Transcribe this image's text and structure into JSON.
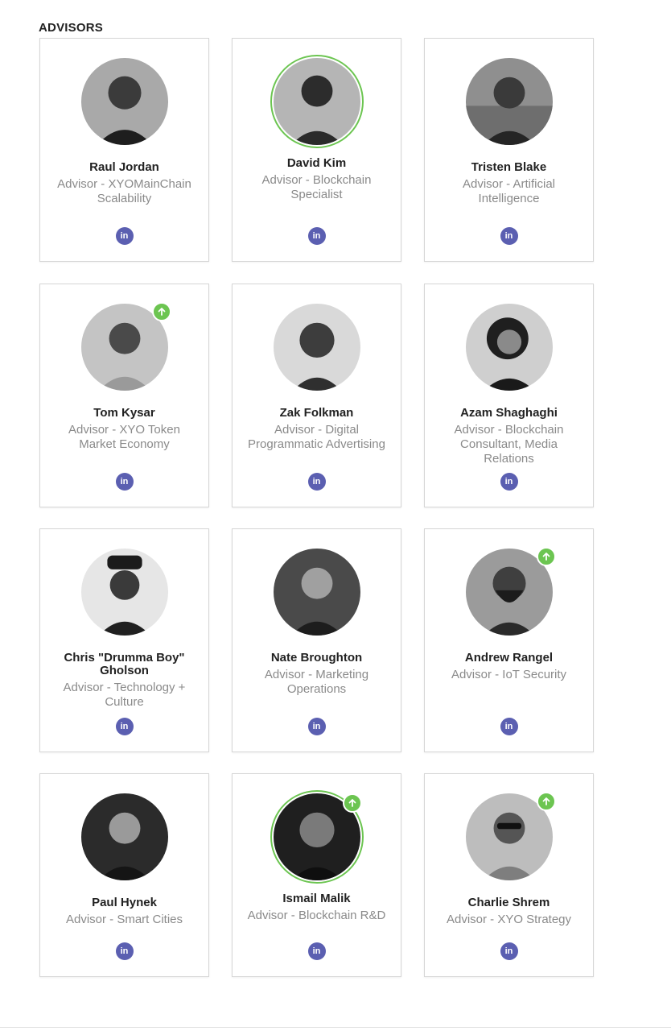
{
  "section": {
    "title": "ADVISORS"
  },
  "linkedin_label": "in",
  "colors": {
    "accent_green": "#6cc551",
    "linkedin": "#5b5fb1"
  },
  "advisors": [
    {
      "name": "Raul Jordan",
      "role": "Advisor - XYOMainChain Scalability",
      "featured": false,
      "badge": false
    },
    {
      "name": "David Kim",
      "role": "Advisor - Blockchain Specialist",
      "featured": true,
      "badge": false
    },
    {
      "name": "Tristen Blake",
      "role": "Advisor - Artificial Intelligence",
      "featured": false,
      "badge": false
    },
    {
      "name": "Tom Kysar",
      "role": "Advisor - XYO Token Market Economy",
      "featured": false,
      "badge": true
    },
    {
      "name": "Zak Folkman",
      "role": "Advisor - Digital Programmatic Advertising",
      "featured": false,
      "badge": false
    },
    {
      "name": "Azam Shaghaghi",
      "role": "Advisor - Blockchain Consultant, Media Relations",
      "featured": false,
      "badge": false
    },
    {
      "name": "Chris \"Drumma Boy\" Gholson",
      "role": "Advisor - Technology + Culture",
      "featured": false,
      "badge": false
    },
    {
      "name": "Nate Broughton",
      "role": "Advisor - Marketing Operations",
      "featured": false,
      "badge": false
    },
    {
      "name": "Andrew Rangel",
      "role": "Advisor - IoT Security",
      "featured": false,
      "badge": true
    },
    {
      "name": "Paul Hynek",
      "role": "Advisor - Smart Cities",
      "featured": false,
      "badge": false
    },
    {
      "name": "Ismail Malik",
      "role": "Advisor - Blockchain R&D",
      "featured": true,
      "badge": true
    },
    {
      "name": "Charlie Shrem",
      "role": "Advisor - XYO Strategy",
      "featured": false,
      "badge": true
    }
  ]
}
